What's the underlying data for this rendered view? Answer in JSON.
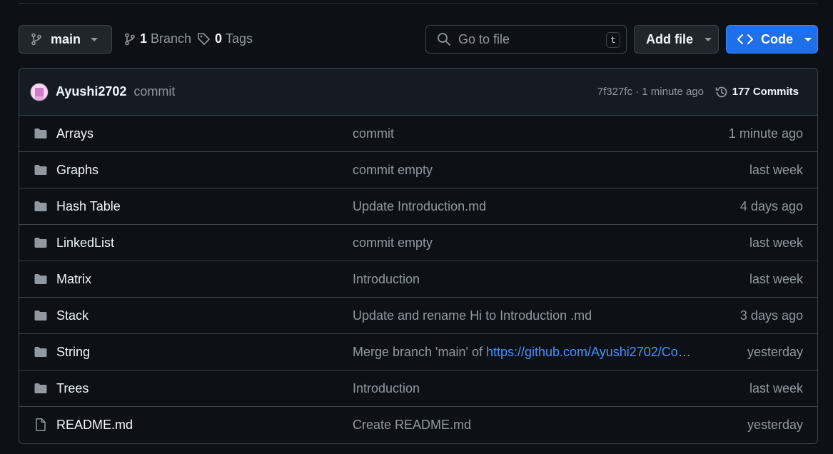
{
  "toolbar": {
    "branch": "main",
    "branch_count": "1",
    "branch_label": "Branch",
    "tag_count": "0",
    "tag_label": "Tags",
    "search_placeholder": "Go to file",
    "search_shortcut": "t",
    "add_file_label": "Add file",
    "code_label": "Code"
  },
  "latest_commit": {
    "author": "Ayushi2702",
    "message": "commit",
    "sha_time": "7f327fc · 1 minute ago",
    "commits_label": "177 Commits"
  },
  "files": [
    {
      "name": "Arrays",
      "type": "folder",
      "message": "commit",
      "time": "1 minute ago"
    },
    {
      "name": "Graphs",
      "type": "folder",
      "message": "commit empty",
      "time": "last week"
    },
    {
      "name": "Hash Table",
      "type": "folder",
      "message": "Update Introduction.md",
      "time": "4 days ago"
    },
    {
      "name": "LinkedList",
      "type": "folder",
      "message": "commit empty",
      "time": "last week"
    },
    {
      "name": "Matrix",
      "type": "folder",
      "message": "Introduction",
      "time": "last week"
    },
    {
      "name": "Stack",
      "type": "folder",
      "message": "Update and rename Hi to Introduction .md",
      "time": "3 days ago"
    },
    {
      "name": "String",
      "type": "folder",
      "message": "Merge branch 'main' of ",
      "link": "https://github.com/Ayushi2702/Com…",
      "time": "yesterday"
    },
    {
      "name": "Trees",
      "type": "folder",
      "message": "Introduction",
      "time": "last week"
    },
    {
      "name": "README.md",
      "type": "file",
      "message": "Create README.md",
      "time": "yesterday"
    }
  ],
  "colors": {
    "background": "#0d1117",
    "border": "#3d444d",
    "primary_button": "#1f6feb",
    "link": "#4493f8",
    "muted_text": "#9198a1"
  },
  "icons": [
    "branch-icon",
    "tag-icon",
    "search-icon",
    "code-icon",
    "history-icon",
    "folder-icon",
    "file-icon",
    "caret-down-icon"
  ]
}
